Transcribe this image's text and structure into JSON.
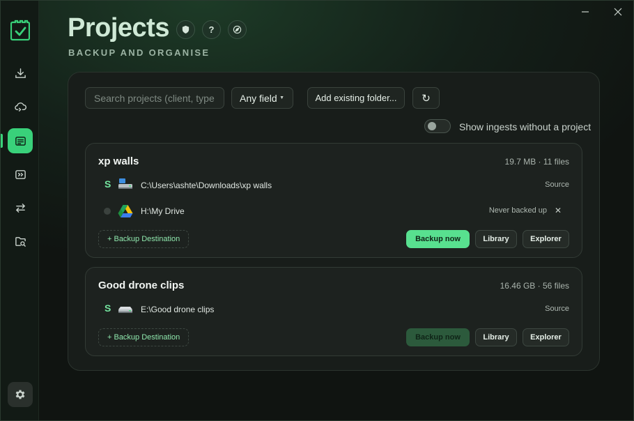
{
  "app": {
    "accent_color": "#39d17a",
    "title": "Projects",
    "subtitle": "BACKUP AND ORGANISE"
  },
  "header_icons": [
    "shield-icon",
    "help-icon",
    "compass-icon"
  ],
  "help_glyph": "?",
  "sidebar": {
    "items": [
      {
        "icon": "download-icon",
        "active": false
      },
      {
        "icon": "cloud-sync-icon",
        "active": false
      },
      {
        "icon": "projects-icon",
        "active": true
      },
      {
        "icon": "media-icon",
        "active": false
      },
      {
        "icon": "transfer-icon",
        "active": false
      },
      {
        "icon": "folder-search-icon",
        "active": false
      }
    ],
    "settings_icon": "gear-icon"
  },
  "toolbar": {
    "search_placeholder": "Search projects (client, type, location...)",
    "field_select": "Any field",
    "add_existing_label": "Add existing folder...",
    "refresh_glyph": "↻",
    "show_ingests_label": "Show ingests without a project",
    "show_ingests_enabled": false
  },
  "projects": [
    {
      "name": "xp walls",
      "meta": "19.7 MB · 11 files",
      "locations": [
        {
          "mark": "S",
          "drive": "local-drive",
          "path": "C:\\Users\\ashte\\Downloads\\xp walls",
          "status": "Source",
          "removable": false
        },
        {
          "mark": "",
          "drive": "google-drive",
          "path": "H:\\My Drive",
          "status": "Never backed up",
          "removable": true
        }
      ],
      "add_destination_label": "+ Backup Destination",
      "backup_label": "Backup now",
      "library_label": "Library",
      "explorer_label": "Explorer",
      "backup_enabled": true
    },
    {
      "name": "Good drone clips",
      "meta": "16.46 GB · 56 files",
      "locations": [
        {
          "mark": "S",
          "drive": "external-drive",
          "path": "E:\\Good drone clips",
          "status": "Source",
          "removable": false
        }
      ],
      "add_destination_label": "+ Backup Destination",
      "backup_label": "Backup now",
      "library_label": "Library",
      "explorer_label": "Explorer",
      "backup_enabled": false
    }
  ],
  "remove_glyph": "✕"
}
